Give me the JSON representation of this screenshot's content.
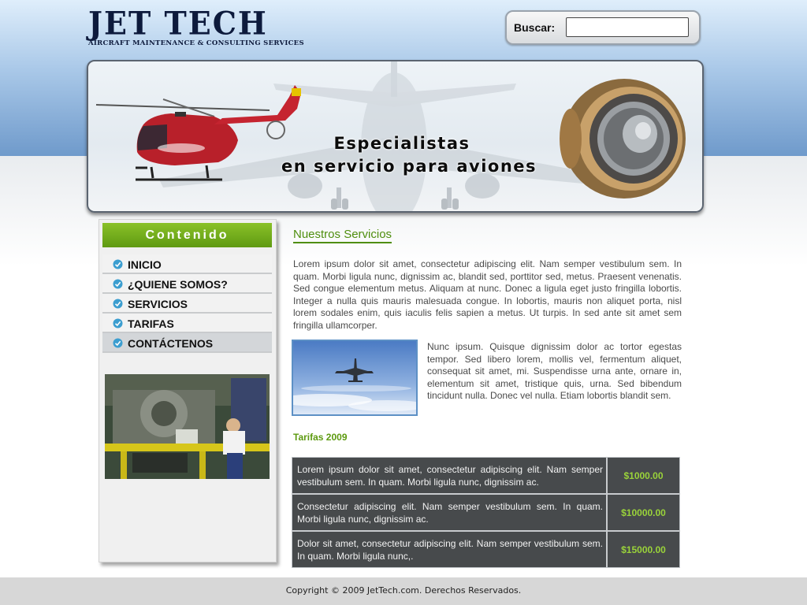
{
  "header": {
    "logo_title": "JET TECH",
    "logo_subtitle": "AIRCRAFT MAINTENANCE & CONSULTING SERVICES"
  },
  "search": {
    "label": "Buscar:",
    "value": "",
    "placeholder": ""
  },
  "banner": {
    "line1": "Especialistas",
    "line2": "en servicio para aviones",
    "images": [
      "helicopter",
      "airliner",
      "jet-engine"
    ]
  },
  "sidebar": {
    "title": "Contenido",
    "items": [
      {
        "label": "INICIO",
        "icon": "check-circle-icon",
        "active": false
      },
      {
        "label": "¿QUIENE SOMOS?",
        "icon": "check-circle-icon",
        "active": false
      },
      {
        "label": "SERVICIOS",
        "icon": "check-circle-icon",
        "active": false
      },
      {
        "label": "TARIFAS",
        "icon": "check-circle-icon",
        "active": false
      },
      {
        "label": "CONTÁCTENOS",
        "icon": "check-circle-icon",
        "active": true
      }
    ],
    "photo": "engine-workshop"
  },
  "main": {
    "title": "Nuestros Servicios",
    "paragraph1": "Lorem ipsum dolor sit amet, consectetur adipiscing elit. Nam semper vestibulum sem. In quam. Morbi ligula nunc, dignissim ac, blandit sed, porttitor sed, metus. Praesent venenatis. Sed congue elementum metus. Aliquam at nunc. Donec a ligula eget justo fringilla lobortis. Integer a nulla quis mauris malesuada congue. In lobortis, mauris non aliquet porta, nisl lorem sodales enim, quis iaculis felis sapien a metus. Ut turpis. In sed ante sit amet sem fringilla ullamcorper.",
    "paragraph2": "Nunc ipsum. Quisque dignissim dolor ac tortor egestas tempor. Sed libero lorem, mollis vel, fermentum aliquet, consequat sit amet, mi. Suspendisse urna ante, ornare in, elementum sit amet, tristique quis, urna. Sed bibendum tincidunt nulla. Donec vel nulla. Etiam lobortis blandit sem.",
    "photo": "airplane-in-sky",
    "rates_title": "Tarifas 2009",
    "rates": [
      {
        "description": "Lorem ipsum dolor sit amet, consectetur adipiscing elit. Nam semper vestibulum sem. In quam. Morbi ligula nunc, dignissim ac.",
        "price": "$1000.00"
      },
      {
        "description": "Consectetur adipiscing elit. Nam semper vestibulum sem. In quam. Morbi ligula nunc, dignissim ac.",
        "price": "$10000.00"
      },
      {
        "description": "Dolor sit amet, consectetur adipiscing elit. Nam semper vestibulum sem. In quam. Morbi ligula nunc,.",
        "price": "$15000.00"
      }
    ]
  },
  "footer": {
    "copyright": "Copyright © 2009 JetTech.com. Derechos Reservados."
  },
  "colors": {
    "accent_green": "#5f9a12",
    "header_blue": "#6f9acb",
    "logo_navy": "#0d1a3c",
    "rate_price": "#9ad33a",
    "table_bg": "#474a4c"
  }
}
